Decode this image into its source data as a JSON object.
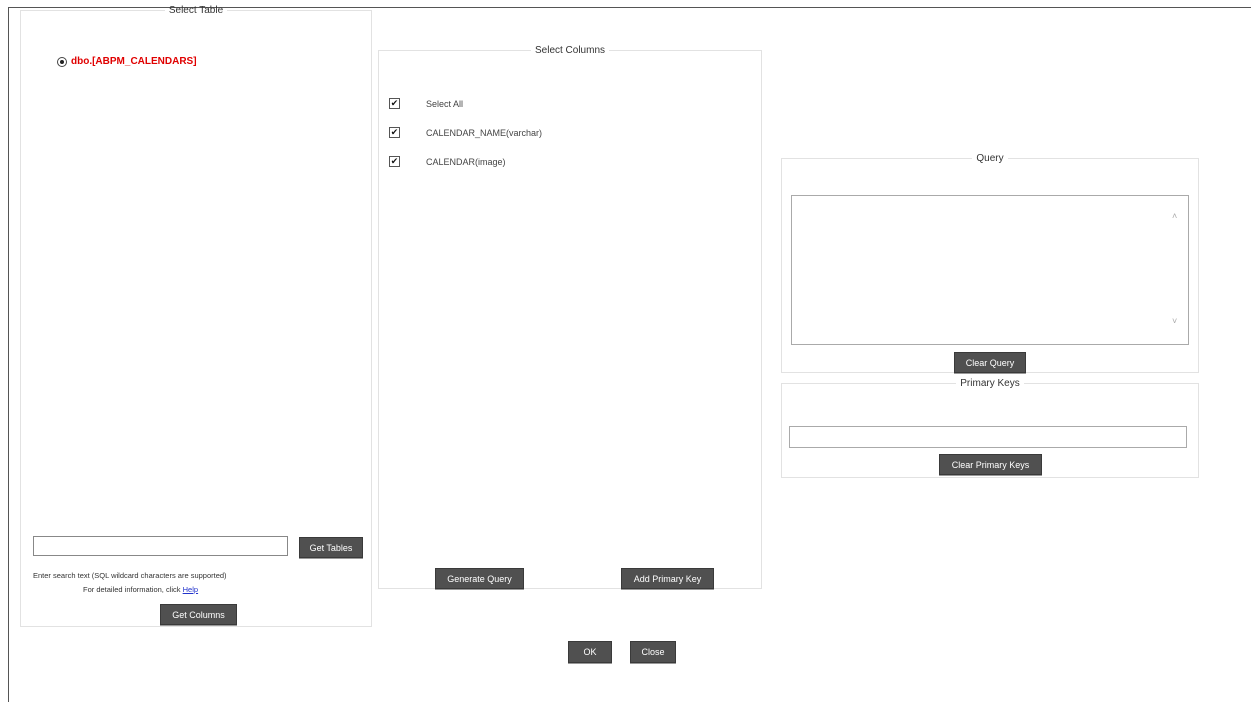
{
  "select_table": {
    "legend": "Select Table",
    "selected_table": "dbo.[ABPM_CALENDARS]",
    "search_placeholder": "",
    "get_tables_label": "Get Tables",
    "hint_line1": "Enter search text (SQL wildcard characters are supported)",
    "hint_line2_prefix": "For detailed information, click",
    "help_link": "Help",
    "get_columns_label": "Get Columns"
  },
  "select_columns": {
    "legend": "Select Columns",
    "items": [
      {
        "label": "Select All",
        "checked": true
      },
      {
        "label": "CALENDAR_NAME(varchar)",
        "checked": true
      },
      {
        "label": "CALENDAR(image)",
        "checked": true
      }
    ],
    "generate_query_label": "Generate Query",
    "add_primary_key_label": "Add Primary Key"
  },
  "query": {
    "legend": "Query",
    "value": "",
    "clear_label": "Clear Query"
  },
  "primary_keys": {
    "legend": "Primary Keys",
    "value": "",
    "clear_label": "Clear Primary Keys"
  },
  "footer": {
    "ok_label": "OK",
    "close_label": "Close"
  },
  "colors": {
    "button_bg": "#505050",
    "table_label": "#e00000",
    "link": "#2233cc"
  }
}
